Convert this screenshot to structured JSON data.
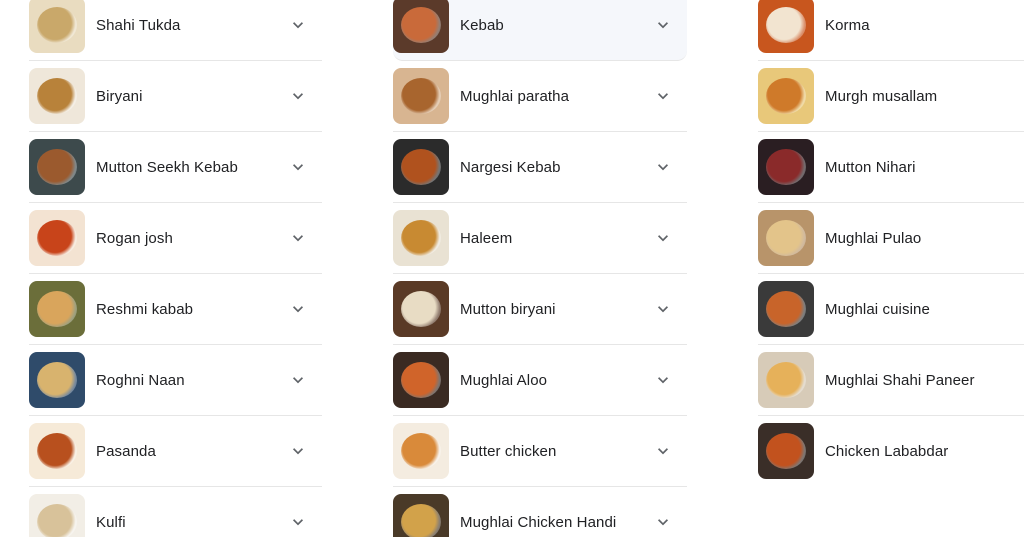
{
  "columns": [
    {
      "items": [
        {
          "label": "Shahi Tukda",
          "thumb": [
            "#e9dcc0",
            "#c9a86a"
          ]
        },
        {
          "label": "Biryani",
          "thumb": [
            "#efe7da",
            "#b8823a"
          ]
        },
        {
          "label": "Mutton Seekh Kebab",
          "thumb": [
            "#3d4a4c",
            "#9b5a2e"
          ]
        },
        {
          "label": "Rogan josh",
          "thumb": [
            "#f3e3d2",
            "#c8441a"
          ]
        },
        {
          "label": "Reshmi kabab",
          "thumb": [
            "#6b6e3a",
            "#d9a55c"
          ]
        },
        {
          "label": "Roghni Naan",
          "thumb": [
            "#2f4b6a",
            "#d8b36e"
          ]
        },
        {
          "label": "Pasanda",
          "thumb": [
            "#f6ead8",
            "#b8501e"
          ]
        },
        {
          "label": "Kulfi",
          "thumb": [
            "#f2eee6",
            "#d8c29a"
          ]
        }
      ]
    },
    {
      "items": [
        {
          "label": "Kebab",
          "thumb": [
            "#5b3a2a",
            "#c96a3a"
          ],
          "highlighted": true
        },
        {
          "label": "Mughlai paratha",
          "thumb": [
            "#d8b591",
            "#a8652e"
          ]
        },
        {
          "label": "Nargesi Kebab",
          "thumb": [
            "#2b2b2b",
            "#b0521e"
          ]
        },
        {
          "label": "Haleem",
          "thumb": [
            "#e9e2d3",
            "#c88a32"
          ]
        },
        {
          "label": "Mutton biryani",
          "thumb": [
            "#5a3a26",
            "#e8dcc4"
          ]
        },
        {
          "label": "Mughlai Aloo",
          "thumb": [
            "#3a2a22",
            "#d0642a"
          ]
        },
        {
          "label": "Butter chicken",
          "thumb": [
            "#f4ece0",
            "#d98a3a"
          ]
        },
        {
          "label": "Mughlai Chicken Handi",
          "thumb": [
            "#4a3a28",
            "#d2a24a"
          ]
        }
      ]
    },
    {
      "items": [
        {
          "label": "Korma",
          "thumb": [
            "#c8561e",
            "#f2e4d0"
          ]
        },
        {
          "label": "Murgh musallam",
          "thumb": [
            "#e8c87a",
            "#cf7a2a"
          ]
        },
        {
          "label": "Mutton Nihari",
          "thumb": [
            "#2a1e22",
            "#8a2a2a"
          ]
        },
        {
          "label": "Mughlai Pulao",
          "thumb": [
            "#b8946a",
            "#e3c48a"
          ]
        },
        {
          "label": "Mughlai cuisine",
          "thumb": [
            "#3a3a3a",
            "#c8642a"
          ]
        },
        {
          "label": "Mughlai Shahi Paneer",
          "thumb": [
            "#d7cbb8",
            "#e6b15a"
          ]
        },
        {
          "label": "Chicken Lababdar",
          "thumb": [
            "#3a2e28",
            "#c2521e"
          ]
        }
      ]
    }
  ],
  "icons": {
    "expand": "chevron-down-icon"
  },
  "colors": {
    "text": "#202124",
    "divider": "#e6e6e6",
    "highlight_bg": "#f5f7fb",
    "chevron": "#5f6368"
  }
}
